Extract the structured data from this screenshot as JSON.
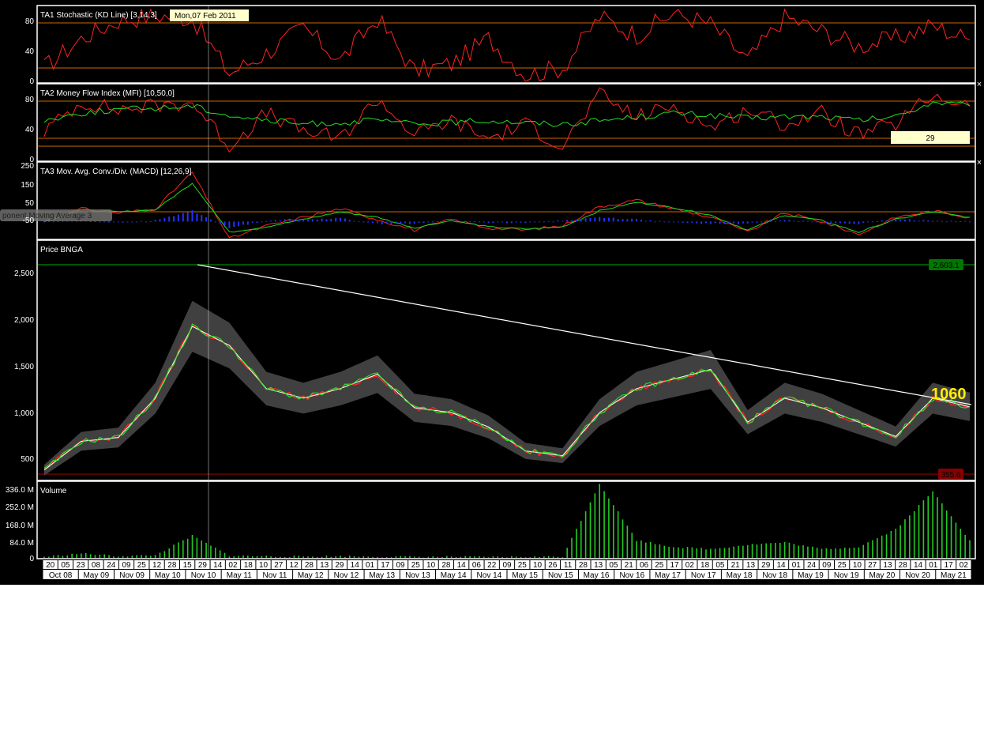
{
  "panels": {
    "stoch": {
      "title": "TA1 Stochastic (KD Line) [3,14,3]",
      "y_ticks": [
        "80",
        "40",
        "0"
      ],
      "tooltip": "Mon,07 Feb 2011"
    },
    "mfi": {
      "title": "TA2 Money Flow Index (MFI) [10,50,0]",
      "y_ticks": [
        "80",
        "40",
        "0"
      ],
      "value_label": "29"
    },
    "macd": {
      "title": "TA3 Mov. Avg. Conv./Div. (MACD) [12,26,9]",
      "y_ticks": [
        "250",
        "150",
        "50",
        "-50"
      ],
      "hint": "ponent Moving Average 3"
    },
    "price": {
      "title": "Price BNGA",
      "y_ticks": [
        "2,500",
        "2,000",
        "1,500",
        "1,000",
        "500"
      ],
      "high_label": "2,603.1",
      "low_label": "355.6",
      "last_label": "1060"
    },
    "volume": {
      "title": "Volume",
      "y_ticks": [
        "336.0 M",
        "252.0 M",
        "168.0 M",
        "84.0 M",
        "0"
      ]
    }
  },
  "close_icon": "×",
  "colors": {
    "background": "#000000",
    "frame": "#ffffff",
    "stoch_k": "#ff2222",
    "stoch_d": "#22dd22",
    "mfi": "#ff2222",
    "mfi_signal": "#22dd22",
    "macd": "#ff2222",
    "macd_signal": "#22dd22",
    "macd_hist": "#2233ff",
    "candle_up": "#22ee22",
    "candle_down": "#ff2222",
    "band": "#555555",
    "volume": "#22cc22",
    "trendline": "#ffffff",
    "level_line": "#cc6600"
  },
  "x_axis": {
    "days": [
      "20",
      "05",
      "23",
      "08",
      "24",
      "09",
      "25",
      "12",
      "28",
      "15",
      "29",
      "14",
      "02",
      "18",
      "10",
      "27",
      "12",
      "28",
      "13",
      "29",
      "14",
      "01",
      "17",
      "09",
      "25",
      "10",
      "28",
      "14",
      "06",
      "22",
      "09",
      "25",
      "10",
      "26",
      "11",
      "28",
      "13",
      "05",
      "21",
      "06",
      "25",
      "17",
      "02",
      "18",
      "05",
      "21",
      "13",
      "29",
      "14",
      "01",
      "24",
      "09",
      "25",
      "10",
      "27",
      "13",
      "28",
      "14",
      "01",
      "17",
      "02"
    ],
    "months": [
      "Oct 08",
      "May 09",
      "Nov 09",
      "May 10",
      "Nov 10",
      "May 11",
      "Nov 11",
      "May 12",
      "Nov 12",
      "May 13",
      "Nov 13",
      "May 14",
      "Nov 14",
      "May 15",
      "Nov 15",
      "May 16",
      "Nov 16",
      "May 17",
      "Nov 17",
      "May 18",
      "Nov 18",
      "May 19",
      "Nov 19",
      "May 20",
      "Nov 20",
      "May 21"
    ]
  },
  "chart_data": [
    {
      "type": "line",
      "title": "TA1 Stochastic (KD Line) [3,14,3]",
      "ylim": [
        0,
        100
      ],
      "levels": [
        80,
        20
      ],
      "x": [
        "Oct 08",
        "May 09",
        "Nov 09",
        "May 10",
        "Nov 10",
        "May 11",
        "Nov 11",
        "May 12",
        "Nov 12",
        "May 13",
        "Nov 13",
        "May 14",
        "Nov 14",
        "May 15",
        "Nov 15",
        "May 16",
        "Nov 16",
        "May 17",
        "Nov 17",
        "May 18",
        "Nov 18",
        "May 19",
        "Nov 19",
        "May 20",
        "Nov 20",
        "May 21"
      ],
      "series": [
        {
          "values": [
            20,
            60,
            85,
            92,
            88,
            12,
            40,
            75,
            30,
            88,
            15,
            25,
            60,
            10,
            20,
            90,
            65,
            95,
            80,
            30,
            90,
            70,
            50,
            60,
            78,
            58
          ]
        }
      ]
    },
    {
      "type": "line",
      "title": "TA2 Money Flow Index (MFI) [10,50,0]",
      "ylim": [
        0,
        100
      ],
      "levels": [
        80,
        30,
        20
      ],
      "x": [
        "Oct 08",
        "May 09",
        "Nov 09",
        "May 10",
        "Nov 10",
        "May 11",
        "Nov 11",
        "May 12",
        "Nov 12",
        "May 13",
        "Nov 13",
        "May 14",
        "Nov 14",
        "May 15",
        "Nov 15",
        "May 16",
        "Nov 16",
        "May 17",
        "Nov 17",
        "May 18",
        "Nov 18",
        "May 19",
        "Nov 19",
        "May 20",
        "Nov 20",
        "May 21"
      ],
      "series": [
        {
          "values": [
            40,
            80,
            70,
            75,
            80,
            20,
            65,
            40,
            30,
            85,
            35,
            55,
            30,
            50,
            20,
            90,
            60,
            75,
            45,
            70,
            50,
            65,
            35,
            50,
            90,
            75
          ]
        },
        {
          "values": [
            55,
            65,
            70,
            72,
            75,
            62,
            55,
            50,
            52,
            55,
            50,
            52,
            55,
            52,
            50,
            55,
            60,
            65,
            62,
            58,
            60,
            60,
            55,
            60,
            80,
            75
          ]
        }
      ]
    },
    {
      "type": "line",
      "title": "TA3 Mov. Avg. Conv./Div. (MACD) [12,26,9]",
      "ylim": [
        -80,
        260
      ],
      "x": [
        "Oct 08",
        "May 09",
        "Nov 09",
        "May 10",
        "Nov 10",
        "May 11",
        "Nov 11",
        "May 12",
        "Nov 12",
        "May 13",
        "Nov 13",
        "May 14",
        "Nov 14",
        "May 15",
        "Nov 15",
        "May 16",
        "Nov 16",
        "May 17",
        "Nov 17",
        "May 18",
        "Nov 18",
        "May 19",
        "Nov 19",
        "May 20",
        "Nov 20",
        "May 21"
      ],
      "series": [
        {
          "values": [
            0,
            60,
            40,
            60,
            230,
            -80,
            -20,
            20,
            60,
            10,
            -40,
            10,
            -30,
            -40,
            -20,
            70,
            100,
            60,
            20,
            -50,
            40,
            0,
            -60,
            20,
            50,
            20
          ]
        },
        {
          "values": [
            0,
            55,
            45,
            55,
            180,
            -50,
            -25,
            10,
            45,
            20,
            -30,
            5,
            -25,
            -35,
            -25,
            50,
            90,
            65,
            30,
            -40,
            30,
            5,
            -50,
            10,
            45,
            20
          ]
        }
      ]
    },
    {
      "type": "line",
      "title": "Price BNGA",
      "ylim": [
        300,
        2650
      ],
      "x": [
        "Oct 08",
        "May 09",
        "Nov 09",
        "May 10",
        "Nov 10",
        "May 11",
        "Nov 11",
        "May 12",
        "Nov 12",
        "May 13",
        "Nov 13",
        "May 14",
        "Nov 14",
        "May 15",
        "Nov 15",
        "May 16",
        "Nov 16",
        "May 17",
        "Nov 17",
        "May 18",
        "Nov 18",
        "May 19",
        "Nov 19",
        "May 20",
        "Nov 20",
        "May 21"
      ],
      "series": [
        {
          "values": [
            400,
            700,
            740,
            1150,
            1900,
            1700,
            1250,
            1150,
            1250,
            1400,
            1050,
            1000,
            850,
            600,
            550,
            1000,
            1250,
            1350,
            1450,
            900,
            1150,
            1050,
            900,
            750,
            1150,
            1060
          ]
        }
      ],
      "annotations": [
        {
          "type": "trendline",
          "from": [
            "Nov 10",
            2603.1
          ],
          "to": [
            "May 21",
            1130
          ]
        },
        {
          "type": "hline",
          "value": 2603.1,
          "label": "2,603.1"
        },
        {
          "type": "hline",
          "value": 355.6,
          "label": "355.6"
        }
      ]
    },
    {
      "type": "bar",
      "title": "Volume",
      "ylim": [
        0,
        336000000
      ],
      "x": [
        "Oct 08",
        "May 09",
        "Nov 09",
        "May 10",
        "Nov 10",
        "May 11",
        "Nov 11",
        "May 12",
        "Nov 12",
        "May 13",
        "Nov 13",
        "May 14",
        "Nov 14",
        "May 15",
        "Nov 15",
        "May 16",
        "Nov 16",
        "May 17",
        "Nov 17",
        "May 18",
        "Nov 18",
        "May 19",
        "Nov 19",
        "May 20",
        "Nov 20",
        "May 21"
      ],
      "values": [
        5000000,
        20000000,
        8000000,
        12000000,
        100000000,
        10000000,
        8000000,
        6000000,
        8000000,
        6000000,
        5000000,
        5000000,
        4000000,
        5000000,
        6000000,
        336000000,
        80000000,
        50000000,
        40000000,
        60000000,
        70000000,
        40000000,
        50000000,
        130000000,
        300000000,
        80000000
      ]
    }
  ]
}
